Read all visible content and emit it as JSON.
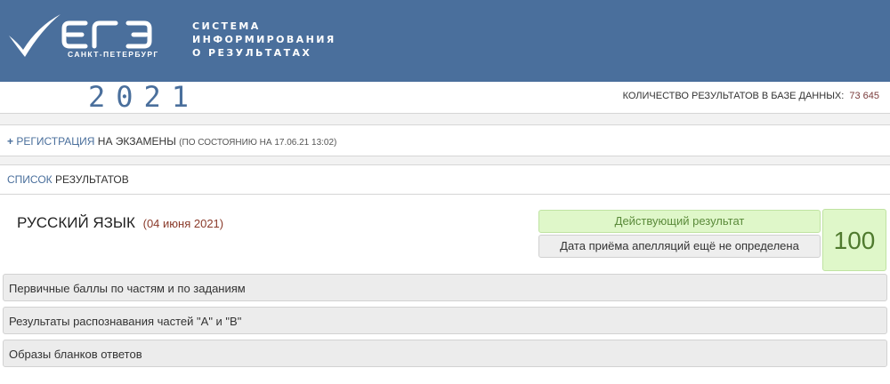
{
  "header": {
    "logo_letters": "ЕГЭ",
    "logo_city": "САНКТ-ПЕТЕРБУРГ",
    "system_lines": [
      "СИСТЕМА",
      "ИНФОРМИРОВАНИЯ",
      "О РЕЗУЛЬТАТАХ"
    ],
    "year": "2021",
    "results_count_label": "КОЛИЧЕСТВО РЕЗУЛЬТАТОВ В БАЗЕ ДАННЫХ:",
    "results_count_value": "73 645"
  },
  "registration": {
    "plus": "+",
    "link_text": "РЕГИСТРАЦИЯ",
    "text": " НА ЭКЗАМЕНЫ",
    "status": "(ПО СОСТОЯНИЮ НА 17.06.21 13:02)"
  },
  "results_list": {
    "link_text": "СПИСОК",
    "text": " РЕЗУЛЬТАТОВ"
  },
  "result": {
    "subject": "РУССКИЙ ЯЗЫК",
    "date": "(04 июня 2021)",
    "status": "Действующий результат",
    "appeal": "Дата приёма апелляций ещё не определена",
    "score": "100"
  },
  "accordions": [
    {
      "label": "Первичные баллы по частям и по заданиям"
    },
    {
      "label": "Результаты распознавания частей \"А\" и \"В\""
    },
    {
      "label": "Образы бланков ответов"
    }
  ],
  "colors": {
    "header_blue": "#4a6f9c",
    "valid_green": "#dff7c9",
    "score_text": "#4f7a2e"
  }
}
